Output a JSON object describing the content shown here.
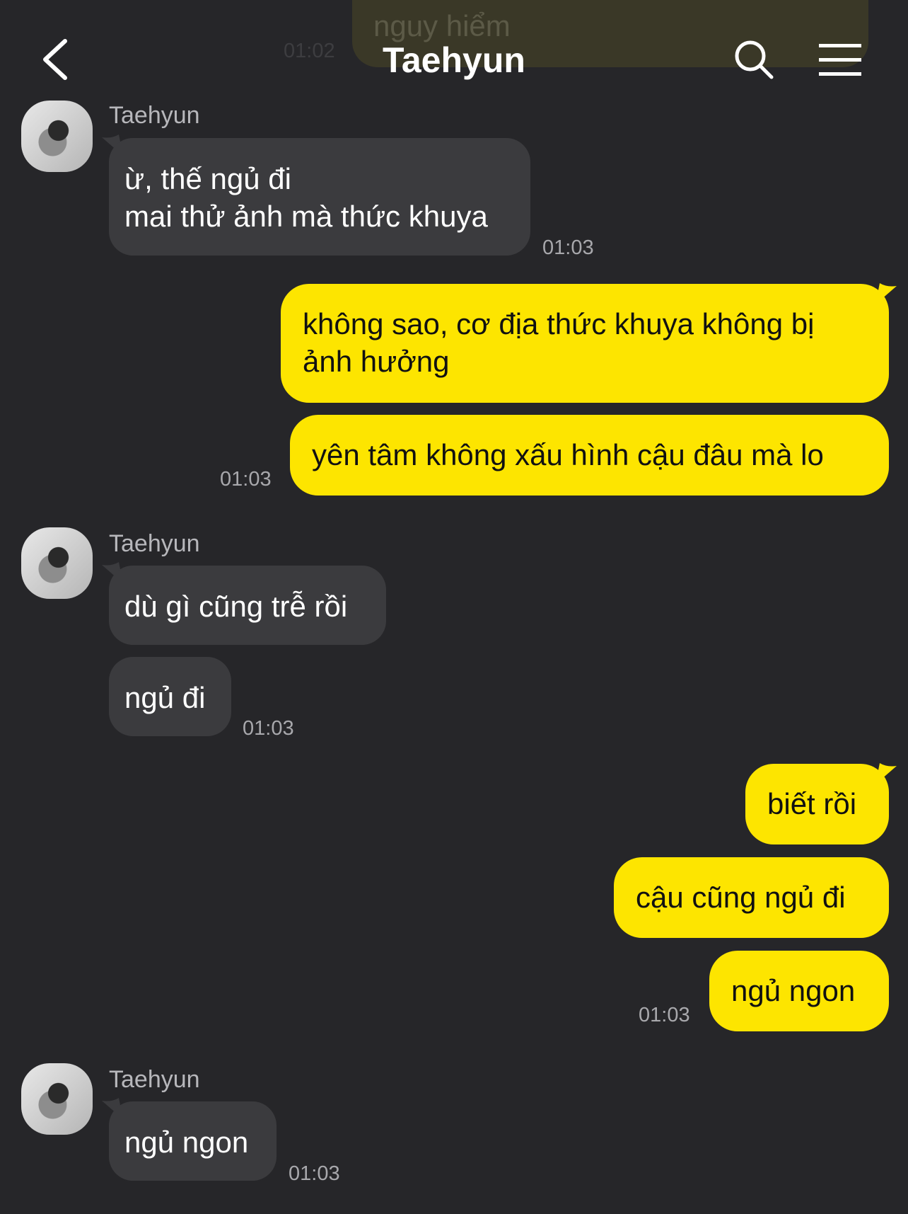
{
  "header": {
    "title": "Taehyun",
    "back_icon": "chevron-left-icon",
    "search_icon": "search-icon",
    "menu_icon": "hamburger-menu-icon"
  },
  "previous_message": {
    "text": "nguy hiểm",
    "time": "01:02"
  },
  "messages": [
    {
      "sender": "Taehyun",
      "lines": [
        "ừ, thế ngủ đi",
        "mai thử ảnh mà thức khuya"
      ],
      "time": "01:03"
    },
    {
      "mine": true,
      "lines": [
        "không sao, cơ địa thức khuya không bị",
        "ảnh hưởng"
      ]
    },
    {
      "mine": true,
      "text": "yên tâm không xấu hình cậu đâu mà lo",
      "time": "01:03"
    },
    {
      "sender": "Taehyun",
      "text": "dù gì cũng trễ rồi"
    },
    {
      "text": "ngủ đi",
      "time": "01:03"
    },
    {
      "mine": true,
      "text": "biết rồi"
    },
    {
      "mine": true,
      "text": "cậu cũng ngủ đi"
    },
    {
      "mine": true,
      "text": "ngủ ngon",
      "time": "01:03"
    },
    {
      "sender": "Taehyun",
      "text": "ngủ ngon",
      "time": "01:03"
    }
  ],
  "colors": {
    "background": "#262629",
    "incoming_bubble": "#3b3b3e",
    "outgoing_bubble": "#fde500",
    "timestamp": "#a8a8ac"
  }
}
